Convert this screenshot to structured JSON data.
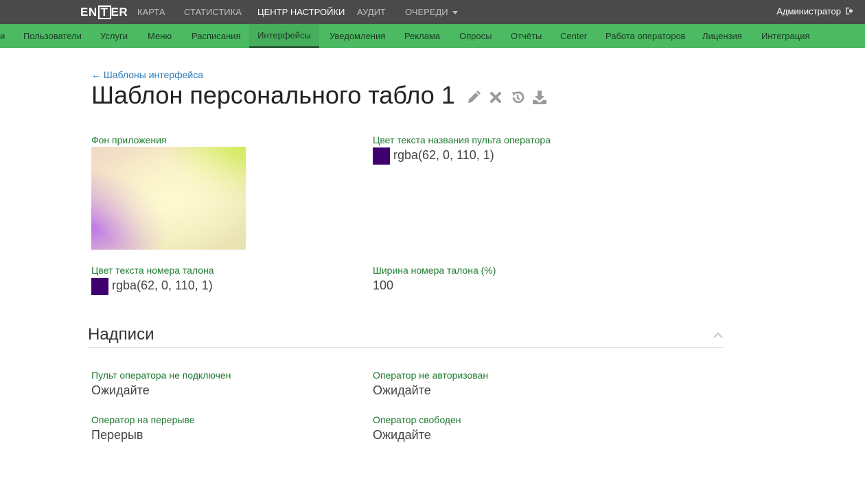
{
  "app": {
    "logo": {
      "prefix": "EN",
      "boxed": "T",
      "suffix": "ER"
    },
    "top_nav": [
      {
        "label": "КАРТА"
      },
      {
        "label": "СТАТИСТИКА"
      },
      {
        "label": "ЦЕНТР НАСТРОЙКИ"
      },
      {
        "label": "АУДИТ"
      },
      {
        "label": "ОЧЕРЕДИ"
      }
    ],
    "user": {
      "label": "Администратор"
    },
    "sub_nav": [
      {
        "label": "и"
      },
      {
        "label": "Пользователи"
      },
      {
        "label": "Услуги"
      },
      {
        "label": "Меню"
      },
      {
        "label": "Расписания"
      },
      {
        "label": "Интерфейсы"
      },
      {
        "label": "Уведомления"
      },
      {
        "label": "Реклама"
      },
      {
        "label": "Опросы"
      },
      {
        "label": "Отчёты"
      },
      {
        "label": "Center"
      },
      {
        "label": "Работа операторов"
      },
      {
        "label": "Лицензия"
      },
      {
        "label": "Интеграция"
      }
    ]
  },
  "page": {
    "back_link": "← Шаблоны интерфейса",
    "title": "Шаблон персонального табло 1",
    "icons": [
      "pencil-icon",
      "close-icon",
      "history-icon",
      "download-icon"
    ]
  },
  "fields": {
    "background": {
      "label": "Фон приложения"
    },
    "operator_name_color": {
      "label": "Цвет текста названия пульта оператора",
      "value": "rgba(62, 0, 110, 1)",
      "color": "#3e006e"
    },
    "ticket_number_color": {
      "label": "Цвет текста номера талона",
      "value": "rgba(62, 0, 110, 1)",
      "color": "#3e006e"
    },
    "ticket_number_width": {
      "label": "Ширина номера талона (%)",
      "value": "100"
    }
  },
  "captions": {
    "title": "Надписи",
    "items": [
      {
        "label": "Пульт оператора не подключен",
        "value": "Ожидайте"
      },
      {
        "label": "Оператор не авторизован",
        "value": "Ожидайте"
      },
      {
        "label": "Оператор на перерыве",
        "value": "Перерыв"
      },
      {
        "label": "Оператор свободен",
        "value": "Ожидайте"
      }
    ]
  },
  "colors": {
    "topbar": "#4a4a4a",
    "subbar": "#4cb963",
    "label_green": "#1e7a30",
    "link_blue": "#2a7ab8"
  }
}
